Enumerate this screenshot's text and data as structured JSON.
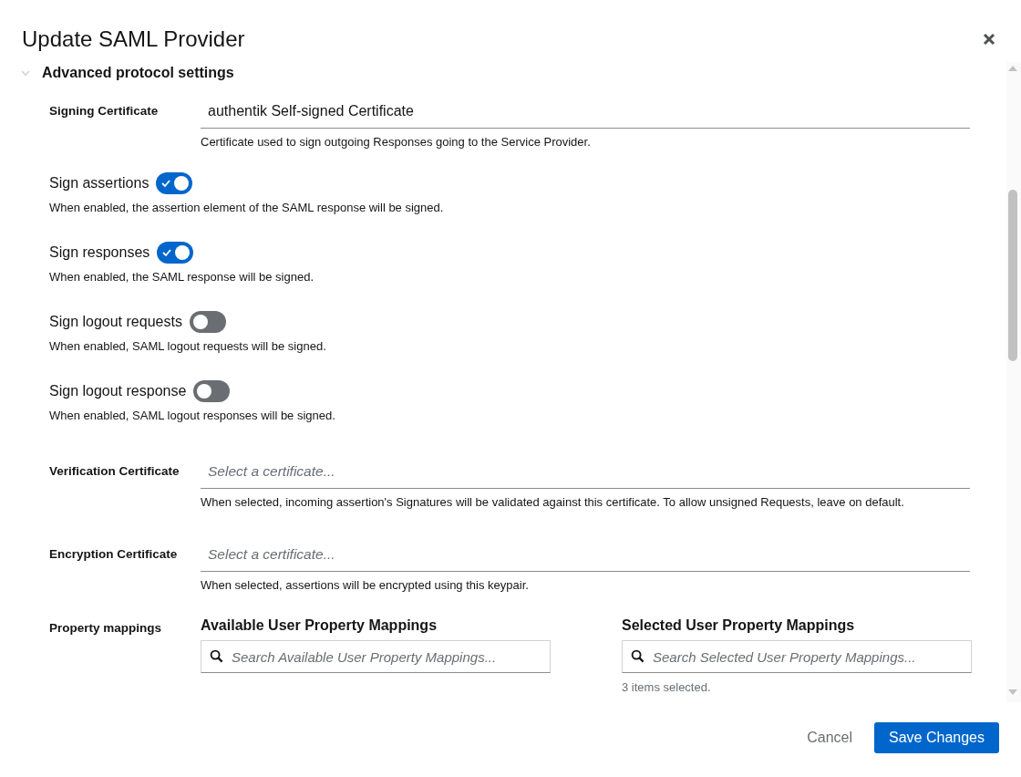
{
  "dialog": {
    "title": "Update SAML Provider"
  },
  "section": {
    "title": "Advanced protocol settings",
    "expanded": true
  },
  "fields": [
    {
      "kind": "select",
      "label": "Signing Certificate",
      "value": "authentik Self-signed Certificate",
      "help": "Certificate used to sign outgoing Responses going to the Service Provider."
    },
    {
      "kind": "switch",
      "label": "Sign assertions",
      "on": true,
      "help": "When enabled, the assertion element of the SAML response will be signed."
    },
    {
      "kind": "switch",
      "label": "Sign responses",
      "on": true,
      "help": "When enabled, the SAML response will be signed."
    },
    {
      "kind": "switch",
      "label": "Sign logout requests",
      "on": false,
      "help": "When enabled, SAML logout requests will be signed."
    },
    {
      "kind": "switch",
      "label": "Sign logout response",
      "on": false,
      "help": "When enabled, SAML logout responses will be signed."
    },
    {
      "kind": "select",
      "label": "Verification Certificate",
      "placeholder": "Select a certificate...",
      "help": "When selected, incoming assertion's Signatures will be validated against this certificate. To allow unsigned Requests, leave on default."
    },
    {
      "kind": "select",
      "label": "Encryption Certificate",
      "placeholder": "Select a certificate...",
      "help": "When selected, assertions will be encrypted using this keypair."
    },
    {
      "kind": "dual_list",
      "label": "Property mappings",
      "available": {
        "title": "Available User Property Mappings",
        "placeholder": "Search Available User Property Mappings..."
      },
      "selected": {
        "title": "Selected User Property Mappings",
        "placeholder": "Search Selected User Property Mappings...",
        "status": "3 items selected."
      }
    }
  ],
  "buttons": [
    {
      "kind": "link",
      "label": "Cancel"
    },
    {
      "kind": "primary",
      "label": "Save Changes"
    }
  ]
}
